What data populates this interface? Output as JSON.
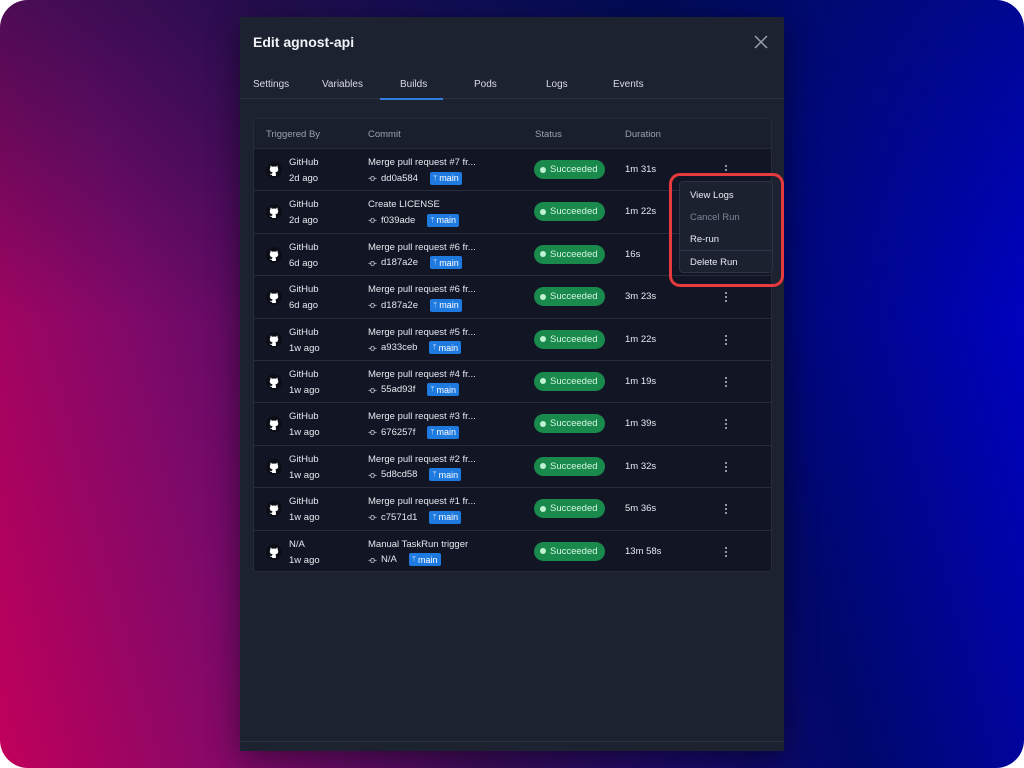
{
  "modal": {
    "title": "Edit agnost-api",
    "close_icon": "close-icon"
  },
  "tabs": [
    {
      "label": "Settings",
      "active": false
    },
    {
      "label": "Variables",
      "active": false
    },
    {
      "label": "Builds",
      "active": true
    },
    {
      "label": "Pods",
      "active": false
    },
    {
      "label": "Logs",
      "active": false
    },
    {
      "label": "Events",
      "active": false
    }
  ],
  "table": {
    "columns": [
      "Triggered By",
      "Commit",
      "Status",
      "Duration"
    ],
    "rows": [
      {
        "trigger": "GitHub",
        "time": "2d ago",
        "message": "Merge pull request #7 fr...",
        "sha": "dd0a584",
        "branch": "main",
        "status": "Succeeded",
        "duration": "1m 31s"
      },
      {
        "trigger": "GitHub",
        "time": "2d ago",
        "message": "Create LICENSE",
        "sha": "f039ade",
        "branch": "main",
        "status": "Succeeded",
        "duration": "1m 22s"
      },
      {
        "trigger": "GitHub",
        "time": "6d ago",
        "message": "Merge pull request #6 fr...",
        "sha": "d187a2e",
        "branch": "main",
        "status": "Succeeded",
        "duration": "16s"
      },
      {
        "trigger": "GitHub",
        "time": "6d ago",
        "message": "Merge pull request #6 fr...",
        "sha": "d187a2e",
        "branch": "main",
        "status": "Succeeded",
        "duration": "3m 23s"
      },
      {
        "trigger": "GitHub",
        "time": "1w ago",
        "message": "Merge pull request #5 fr...",
        "sha": "a933ceb",
        "branch": "main",
        "status": "Succeeded",
        "duration": "1m 22s"
      },
      {
        "trigger": "GitHub",
        "time": "1w ago",
        "message": "Merge pull request #4 fr...",
        "sha": "55ad93f",
        "branch": "main",
        "status": "Succeeded",
        "duration": "1m 19s"
      },
      {
        "trigger": "GitHub",
        "time": "1w ago",
        "message": "Merge pull request #3 fr...",
        "sha": "676257f",
        "branch": "main",
        "status": "Succeeded",
        "duration": "1m 39s"
      },
      {
        "trigger": "GitHub",
        "time": "1w ago",
        "message": "Merge pull request #2 fr...",
        "sha": "5d8cd58",
        "branch": "main",
        "status": "Succeeded",
        "duration": "1m 32s"
      },
      {
        "trigger": "GitHub",
        "time": "1w ago",
        "message": "Merge pull request #1 fr...",
        "sha": "c7571d1",
        "branch": "main",
        "status": "Succeeded",
        "duration": "5m 36s"
      },
      {
        "trigger": "N/A",
        "time": "1w ago",
        "message": "Manual TaskRun trigger",
        "sha": "N/A",
        "branch": "main",
        "status": "Succeeded",
        "duration": "13m 58s"
      }
    ]
  },
  "row_menu": {
    "items": [
      {
        "label": "View Logs",
        "disabled": false
      },
      {
        "label": "Cancel Run",
        "disabled": true
      },
      {
        "label": "Re-run",
        "disabled": false
      },
      {
        "label": "Delete Run",
        "disabled": false
      }
    ]
  },
  "icons": {
    "commit": "-o-",
    "branch": "ᛘ"
  },
  "colors": {
    "accent": "#2f7de1",
    "status_success": "#198a4c",
    "branch_badge": "#1f7ae0",
    "highlight": "#e63a3f"
  }
}
